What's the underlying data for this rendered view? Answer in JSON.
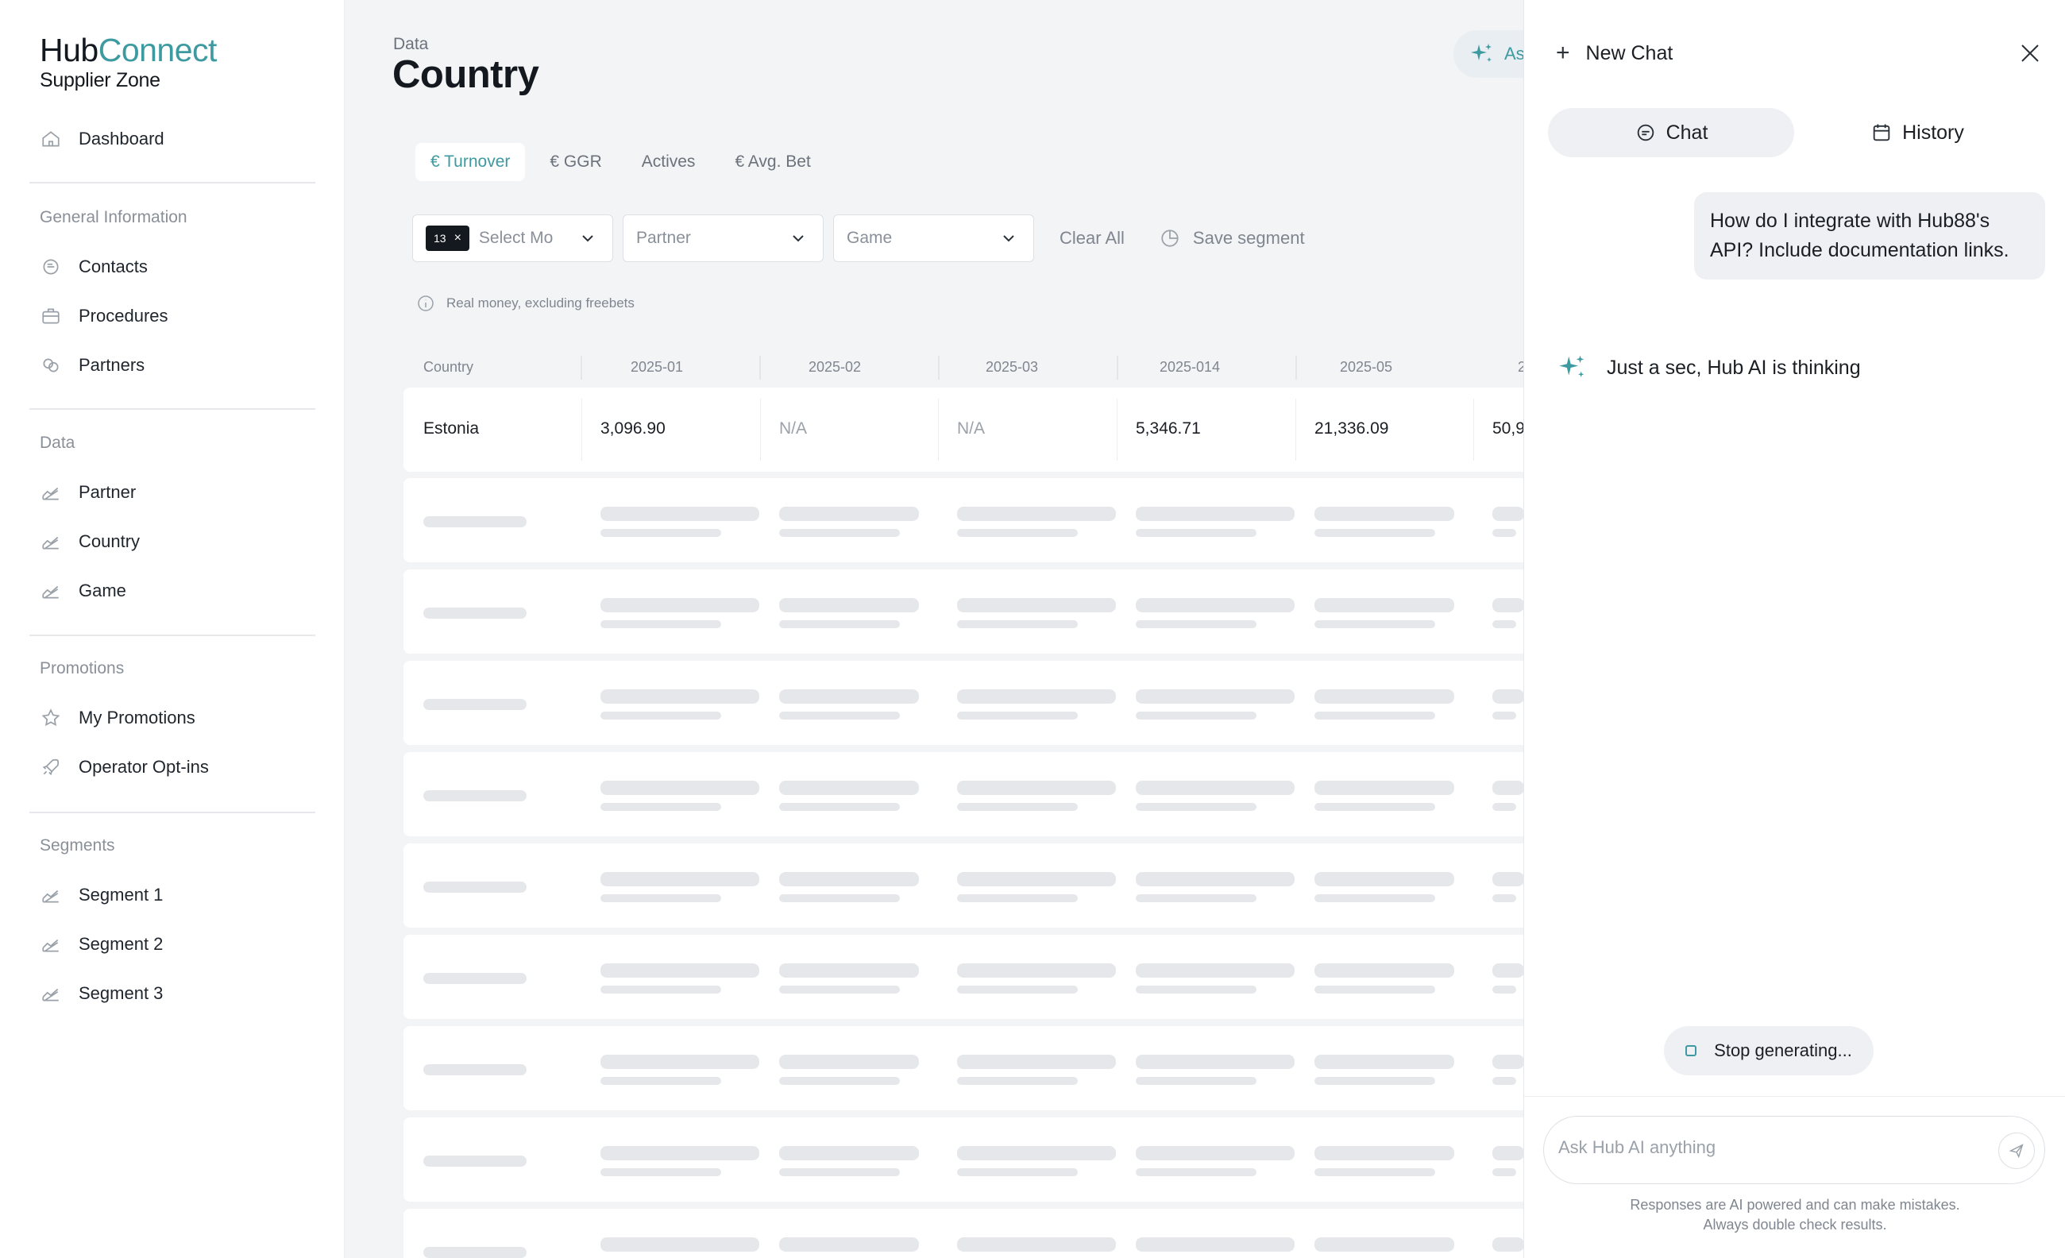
{
  "brand": {
    "hub": "Hub",
    "connect": "Connect",
    "sub": "Supplier Zone"
  },
  "sidebar": {
    "dashboard": "Dashboard",
    "sections": {
      "general": "General Information",
      "data": "Data",
      "promotions": "Promotions",
      "segments": "Segments"
    },
    "general_items": [
      "Contacts",
      "Procedures",
      "Partners"
    ],
    "data_items": [
      "Partner",
      "Country",
      "Game"
    ],
    "promo_items": [
      "My Promotions",
      "Operator Opt-ins"
    ],
    "segment_items": [
      "Segment 1",
      "Segment 2",
      "Segment 3"
    ]
  },
  "header": {
    "breadcrumb": "Data",
    "title": "Country",
    "ask_label": "Ask"
  },
  "tabs": [
    "€ Turnover",
    "€ GGR",
    "Actives",
    "€ Avg. Bet"
  ],
  "filters": {
    "chip_count": "13",
    "months_placeholder": "Select Mo",
    "partner_placeholder": "Partner",
    "game_placeholder": "Game",
    "clear_all": "Clear All",
    "save_segment": "Save segment"
  },
  "note": "Real money, excluding freebets",
  "table": {
    "columns": [
      "Country",
      "2025-01",
      "2025-02",
      "2025-03",
      "2025-014",
      "2025-05",
      "2"
    ],
    "first_row": [
      "Estonia",
      "3,096.90",
      "N/A",
      "N/A",
      "5,346.71",
      "21,336.09",
      "50,9"
    ]
  },
  "chat": {
    "new_chat": "New Chat",
    "tab_chat": "Chat",
    "tab_history": "History",
    "user_message": "How do I integrate with Hub88's API? Include documentation links.",
    "thinking": "Just a sec, Hub AI is thinking",
    "stop": "Stop generating...",
    "input_placeholder": "Ask Hub AI anything",
    "disclaimer_1": "Responses are AI powered and can make mistakes.",
    "disclaimer_2": "Always double check results."
  },
  "colors": {
    "accent": "#3d9aa0",
    "dark": "#14191f"
  }
}
